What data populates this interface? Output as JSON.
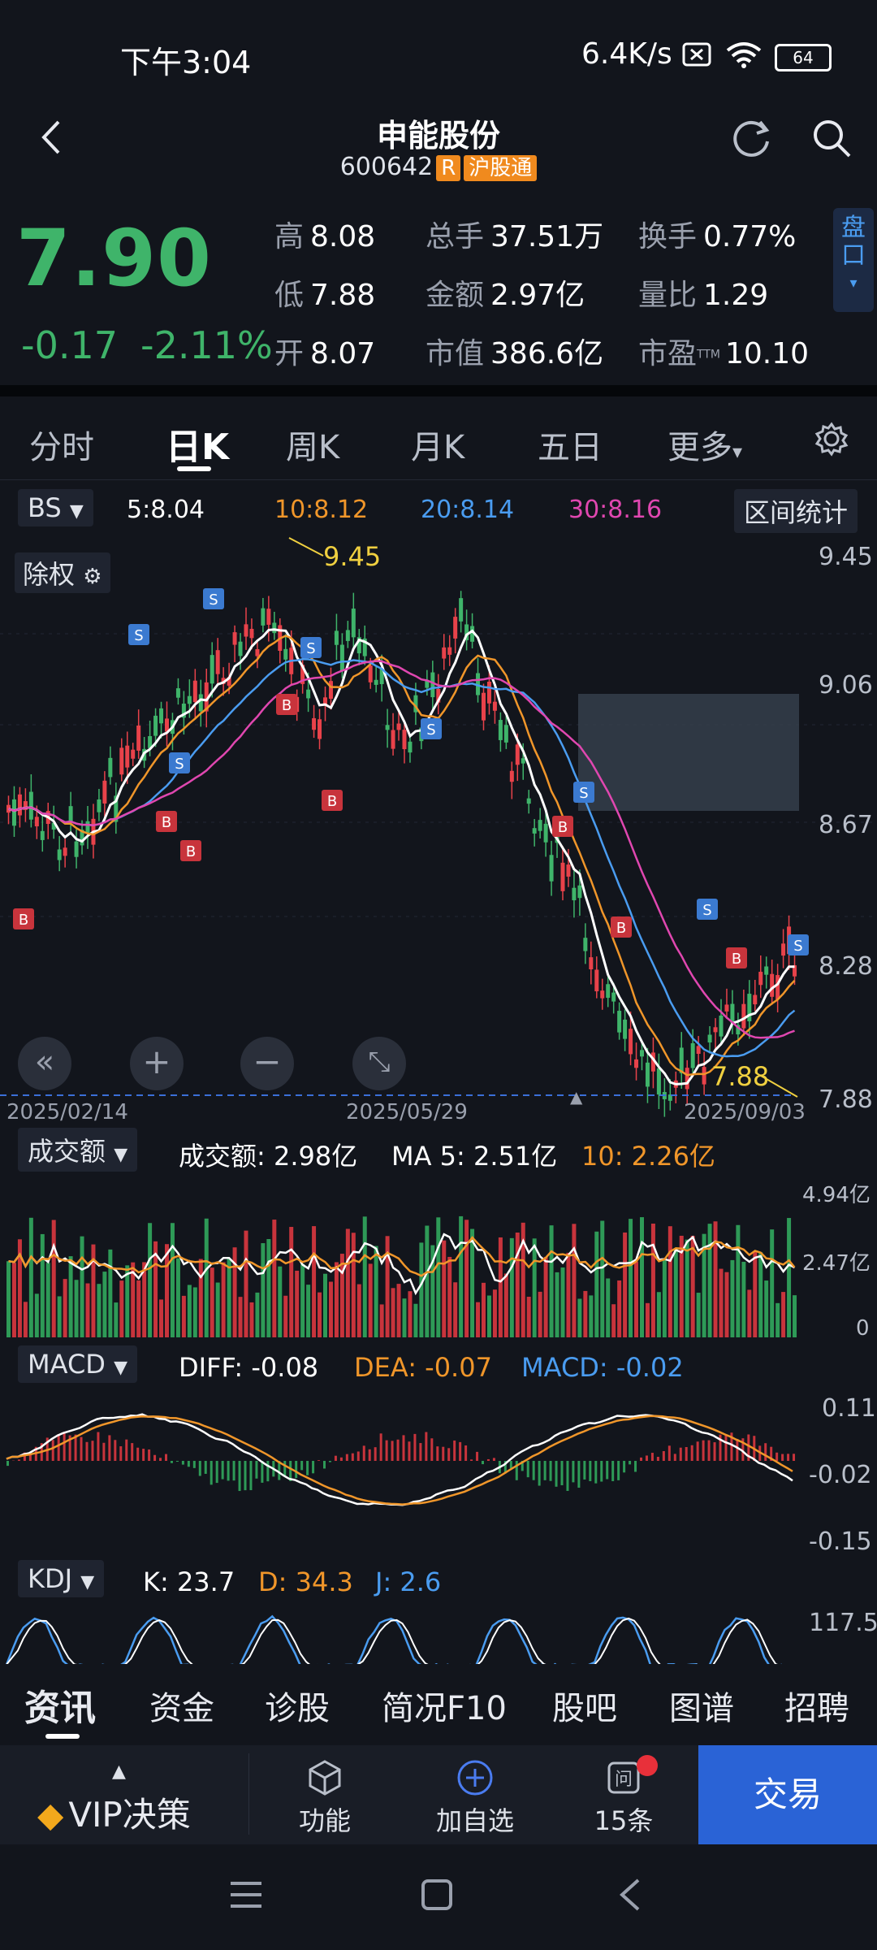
{
  "status": {
    "time": "下午3:04",
    "net_speed": "6.4K/s",
    "battery": "64"
  },
  "header": {
    "name": "申能股份",
    "code": "600642",
    "tag_r": "R",
    "tag_connect": "沪股通"
  },
  "quote": {
    "price": "7.90",
    "change": "-0.17",
    "change_pct": "-2.11%",
    "high_label": "高",
    "high": "8.08",
    "low_label": "低",
    "low": "7.88",
    "open_label": "开",
    "open": "8.07",
    "vol_label": "总手",
    "vol": "37.51万",
    "amount_label": "金额",
    "amount": "2.97亿",
    "mktcap_label": "市值",
    "mktcap": "386.6亿",
    "turnover_label": "换手",
    "turnover": "0.77%",
    "vol_ratio_label": "量比",
    "vol_ratio": "1.29",
    "pe_label": "市盈",
    "pe_sup": "TTM",
    "pe": "10.10",
    "side_button": "盘口"
  },
  "tabs": [
    "分时",
    "日K",
    "周K",
    "月K",
    "五日",
    "更多"
  ],
  "active_tab": "日K",
  "ma": {
    "bs": "BS",
    "ma5": "5:8.04",
    "ma10": "10:8.12",
    "ma20": "20:8.14",
    "ma30": "30:8.16",
    "range_btn": "区间统计"
  },
  "kchart": {
    "exright": "除权",
    "high_mark": "9.45",
    "low_mark": "7.88",
    "y_ticks": [
      "9.45",
      "9.06",
      "8.67",
      "8.28",
      "7.88"
    ],
    "dates": [
      "2025/02/14",
      "2025/05/29",
      "2025/09/03"
    ]
  },
  "volume": {
    "selector": "成交额",
    "label": "成交额: 2.98亿",
    "ma5": "MA 5: 2.51亿",
    "ma10": "10: 2.26亿",
    "ticks": [
      "4.94亿",
      "2.47亿",
      "0"
    ]
  },
  "macd": {
    "selector": "MACD",
    "diff": "DIFF: -0.08",
    "dea": "DEA: -0.07",
    "macd": "MACD: -0.02",
    "ticks": [
      "0.11",
      "-0.02",
      "-0.15"
    ]
  },
  "kdj": {
    "selector": "KDJ",
    "k": "K: 23.7",
    "d": "D: 34.3",
    "j": "J: 2.6",
    "tick": "117.5"
  },
  "news_tabs": [
    "资讯",
    "资金",
    "诊股",
    "简况F10",
    "股吧",
    "图谱",
    "招聘"
  ],
  "bottom": {
    "vip": "VIP决策",
    "func": "功能",
    "add": "加自选",
    "ask": "15条",
    "trade": "交易"
  },
  "colors": {
    "up": "#e8424a",
    "down": "#3fb46a",
    "ma10": "#f0962a",
    "ma20": "#4a9cf0",
    "ma30": "#e047b0",
    "trade": "#2a63d6"
  }
}
